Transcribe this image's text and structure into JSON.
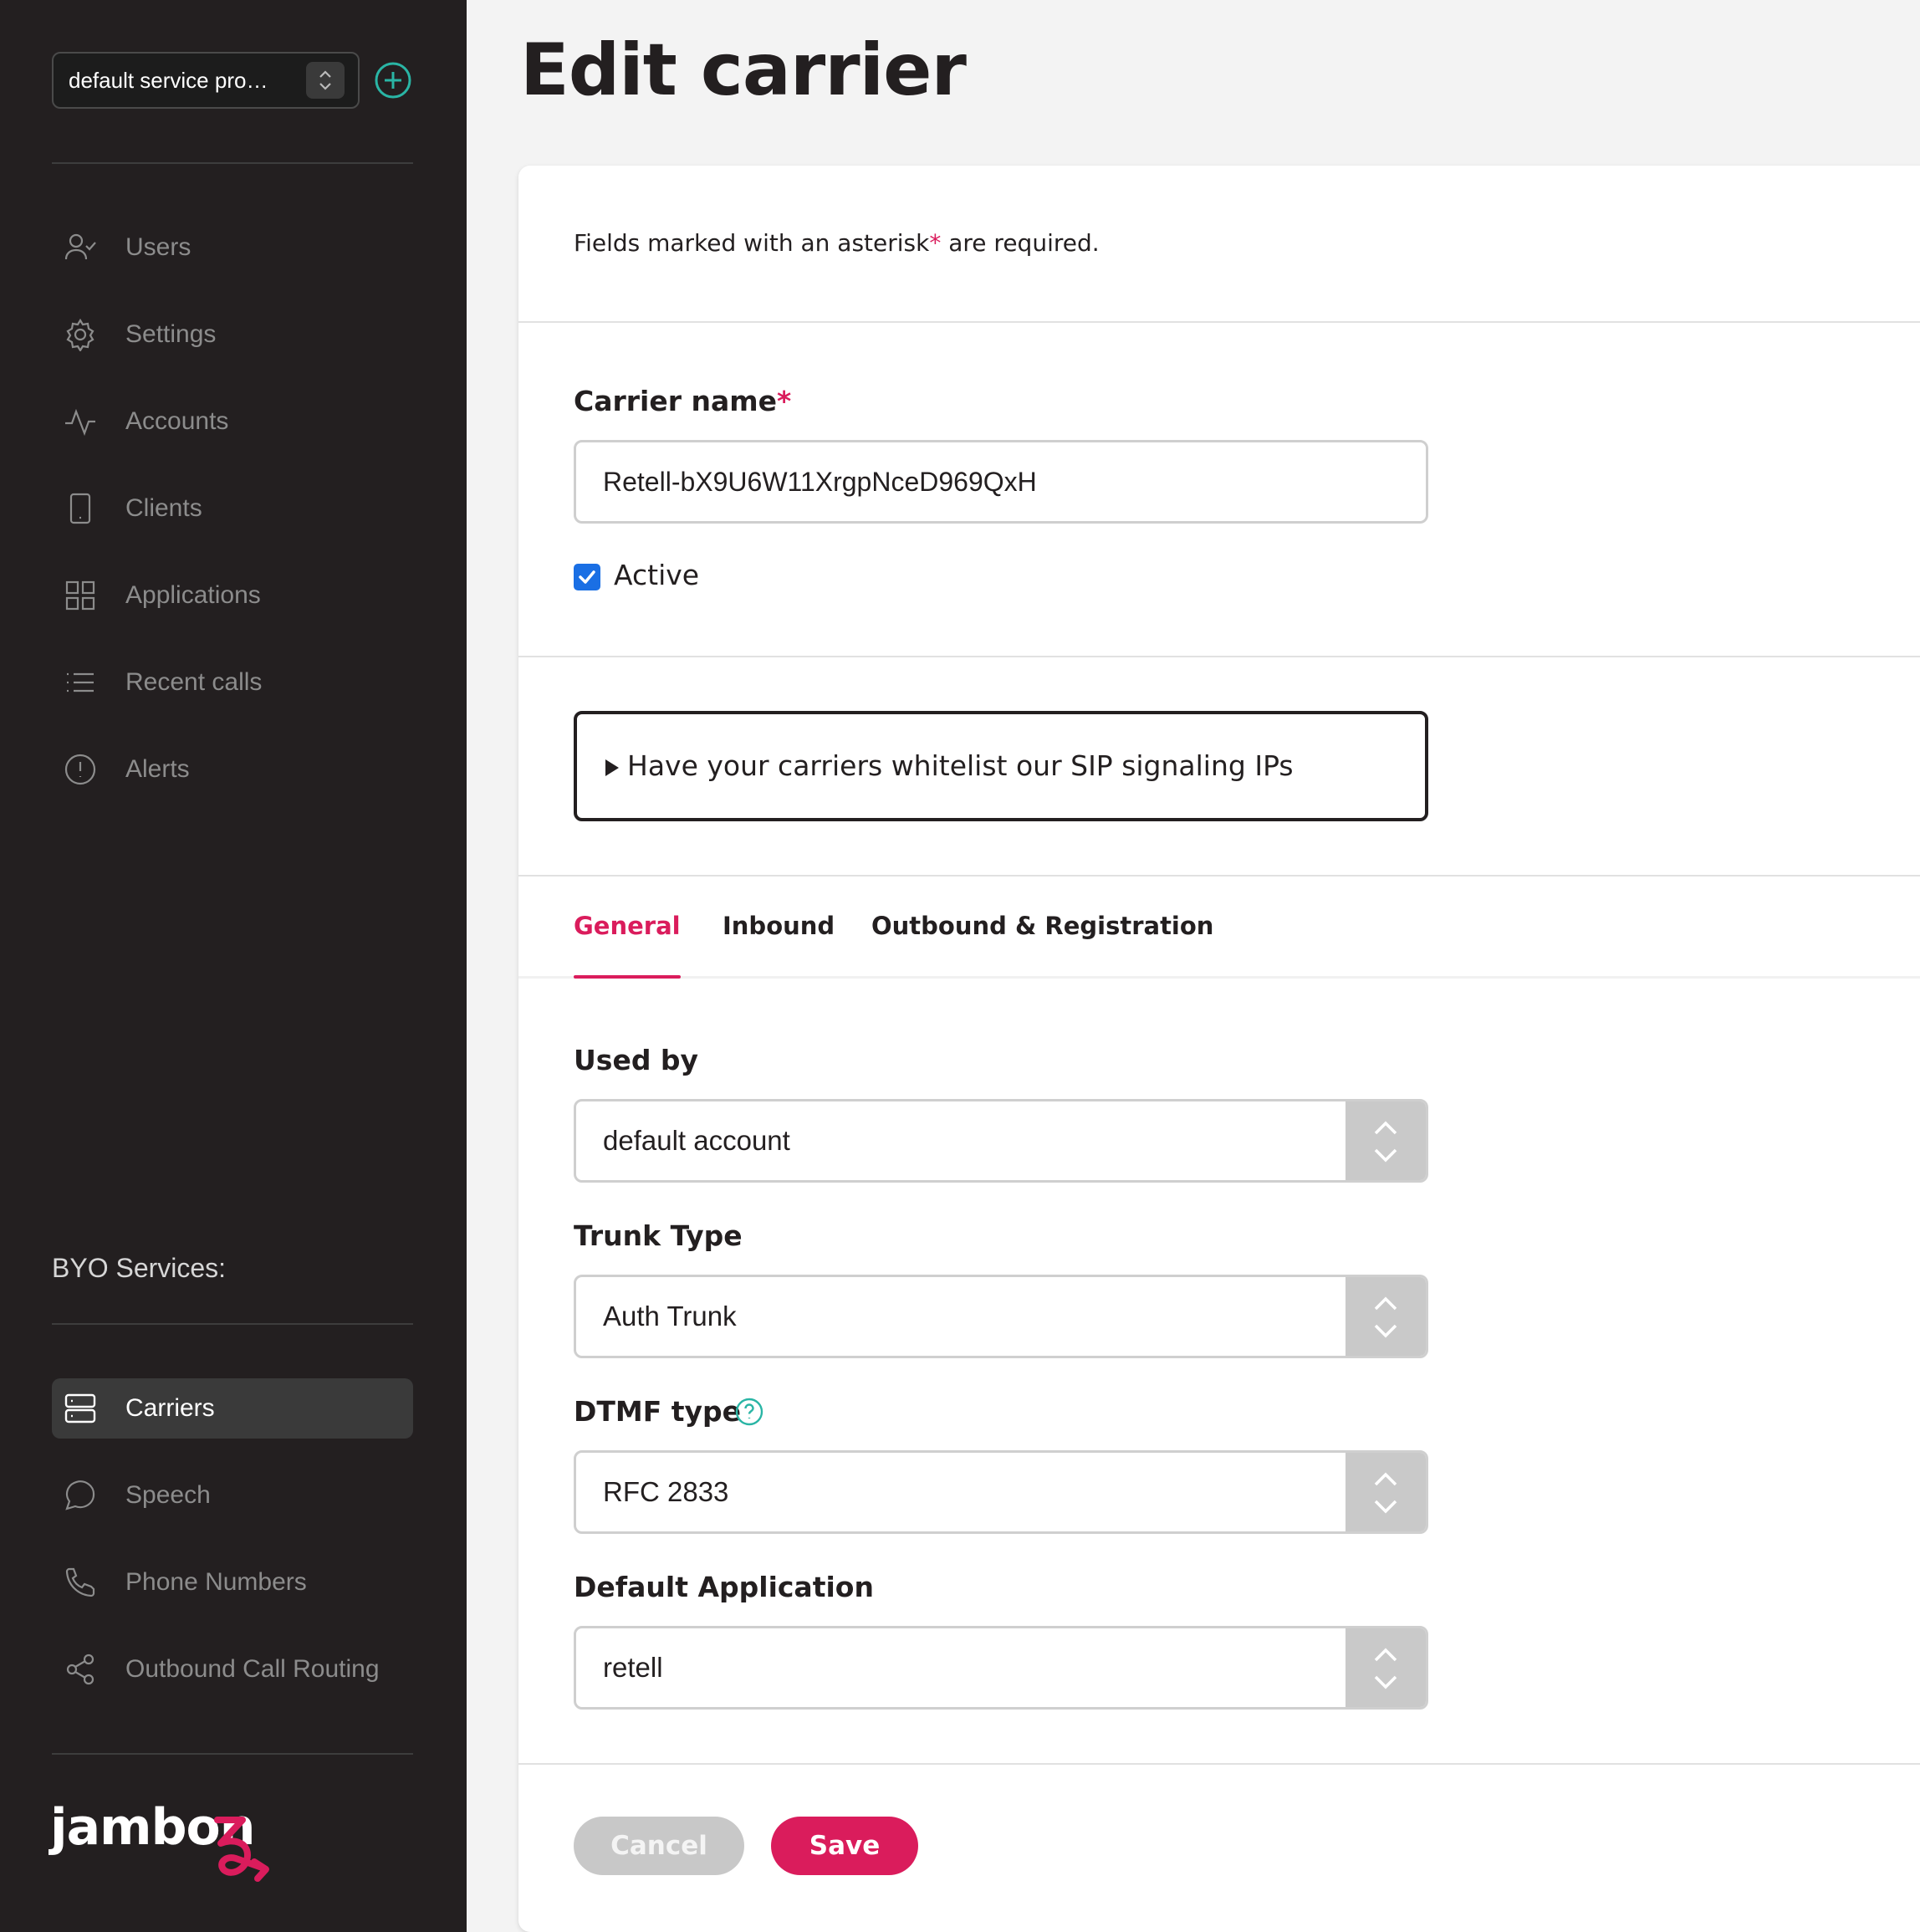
{
  "sidebar": {
    "service_provider": "default service pro…",
    "nav": [
      {
        "label": "Users",
        "icon": "user-check-icon"
      },
      {
        "label": "Settings",
        "icon": "gear-icon"
      },
      {
        "label": "Accounts",
        "icon": "activity-icon"
      },
      {
        "label": "Clients",
        "icon": "smartphone-icon"
      },
      {
        "label": "Applications",
        "icon": "grid-icon"
      },
      {
        "label": "Recent calls",
        "icon": "list-icon"
      },
      {
        "label": "Alerts",
        "icon": "alert-circle-icon"
      }
    ],
    "byo_heading": "BYO Services:",
    "byo_nav": [
      {
        "label": "Carriers",
        "icon": "server-icon",
        "active": true
      },
      {
        "label": "Speech",
        "icon": "message-circle-icon"
      },
      {
        "label": "Phone Numbers",
        "icon": "phone-icon"
      },
      {
        "label": "Outbound Call Routing",
        "icon": "share-icon"
      }
    ],
    "logo_text": "jambon"
  },
  "page": {
    "title": "Edit carrier",
    "required_note_prefix": "Fields marked with an asterisk",
    "required_note_star": "*",
    "required_note_suffix": " are required."
  },
  "form": {
    "carrier_name_label": "Carrier name",
    "carrier_name_value": "Retell-bX9U6W11XrgpNceD969QxH",
    "active_label": "Active",
    "active_checked": true,
    "whitelist_summary": "Have your carriers whitelist our SIP signaling IPs",
    "tabs": [
      {
        "label": "General",
        "active": true
      },
      {
        "label": "Inbound"
      },
      {
        "label": "Outbound & Registration"
      }
    ],
    "used_by_label": "Used by",
    "used_by_value": "default account",
    "trunk_type_label": "Trunk Type",
    "trunk_type_value": "Auth Trunk",
    "dtmf_type_label": "DTMF type",
    "dtmf_type_value": "RFC 2833",
    "default_app_label": "Default Application",
    "default_app_value": "retell",
    "cancel_label": "Cancel",
    "save_label": "Save"
  },
  "colors": {
    "brand": "#da1c5c",
    "sidebar_bg": "#231f20",
    "accent_teal": "#2ab5a5",
    "checkbox_blue": "#1a6fe4"
  }
}
